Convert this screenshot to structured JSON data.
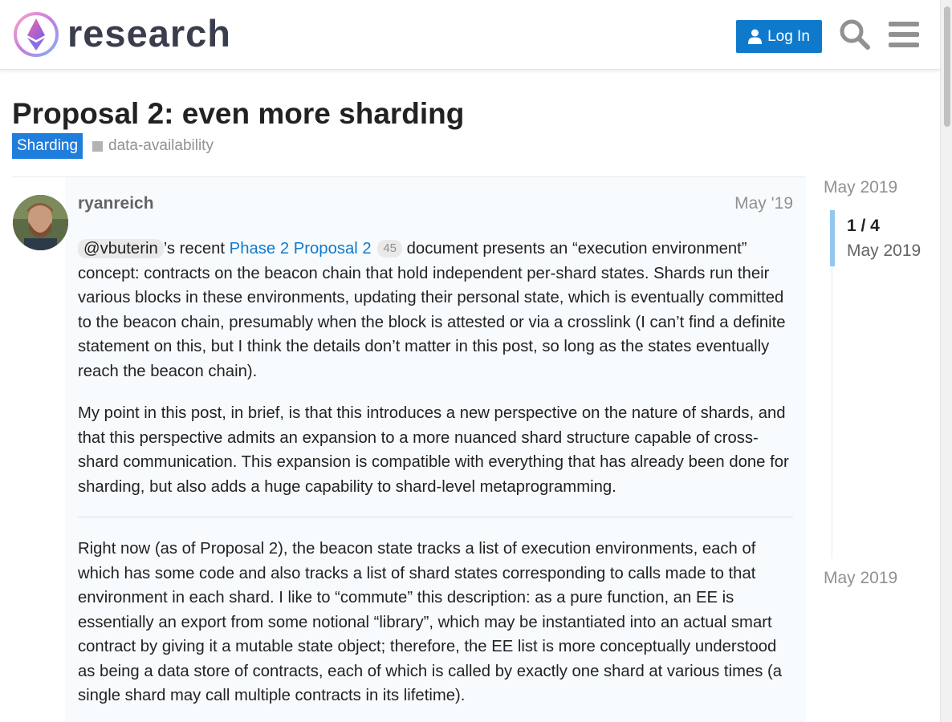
{
  "header": {
    "logo_text": "research",
    "login_label": "Log In",
    "search_icon": "search-icon",
    "menu_icon": "hamburger-menu-icon"
  },
  "topic": {
    "title": "Proposal 2: even more sharding",
    "category": "Sharding",
    "tag": "data-availability"
  },
  "post": {
    "username": "ryanreich",
    "date": "May '19",
    "p1": {
      "mention": "@vbuterin",
      "text_a": "’s recent ",
      "link": "Phase 2 Proposal 2",
      "clicks": "45",
      "text_b": " document presents an “execution environment” concept: contracts on the beacon chain that hold independent per-shard states. Shards run their various blocks in these environments, updating their personal state, which is eventually committed to the beacon chain, presumably when the block is attested or via a crosslink (I can’t find a definite statement on this, but I think the details don’t matter in this post, so long as the states eventually reach the beacon chain)."
    },
    "p2": "My point in this post, in brief, is that this introduces a new perspective on the nature of shards, and that this perspective admits an expansion to a more nuanced shard structure capable of cross-shard communication. This expansion is compatible with everything that has already been done for sharding, but also adds a huge capability to shard-level metaprogramming.",
    "p3": "Right now (as of Proposal 2), the beacon state tracks a list of execution environments, each of which has some code and also tracks a list of shard states corresponding to calls made to that environment in each shard. I like to “commute” this description: as a pure function, an EE is essentially an export from some notional “library”, which may be instantiated into an actual smart contract by giving it a mutable state object; therefore, the EE list is more conceptually understood as being a data store of contracts, each of which is called by exactly one shard at various times (a single shard may call multiple contracts in its lifetime)."
  },
  "timeline": {
    "top_date": "May 2019",
    "position": "1 / 4",
    "current_date": "May 2019",
    "bottom_date": "May 2019"
  },
  "colors": {
    "brand_blue": "#0f7acc",
    "category": "#1f7ddc",
    "muted": "#919191"
  }
}
